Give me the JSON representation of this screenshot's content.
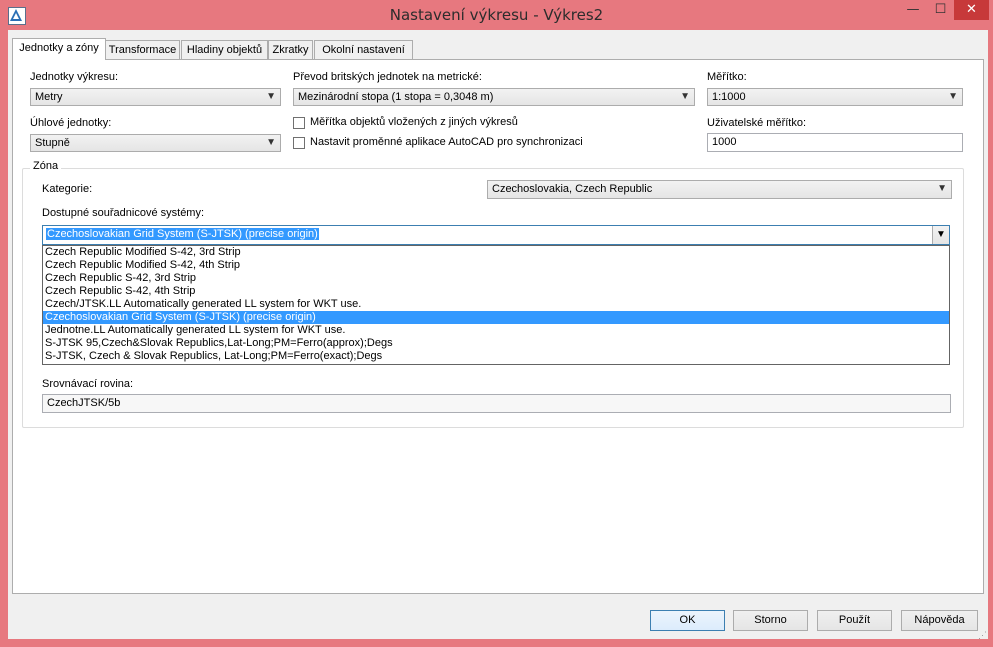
{
  "window": {
    "title": "Nastavení výkresu - Výkres2",
    "min_label": "—",
    "max_label": "☐",
    "close_label": "✕"
  },
  "tabs": [
    {
      "label": "Jednotky a zóny",
      "active": true
    },
    {
      "label": "Transformace",
      "active": false
    },
    {
      "label": "Hladiny objektů",
      "active": false
    },
    {
      "label": "Zkratky",
      "active": false
    },
    {
      "label": "Okolní nastavení",
      "active": false
    }
  ],
  "units": {
    "drawing_units_label": "Jednotky výkresu:",
    "drawing_units_value": "Metry",
    "angular_units_label": "Úhlové jednotky:",
    "angular_units_value": "Stupně",
    "imperial_label": "Převod britských jednotek na metrické:",
    "imperial_value": "Mezinárodní stopa (1 stopa = 0,3048 m)",
    "scale_objects_label": "Měřítka objektů vložených z jiných výkresů",
    "scale_objects_checked": false,
    "sync_label": "Nastavit proměnné aplikace AutoCAD pro synchronizaci",
    "sync_checked": false,
    "scale_label": "Měřítko:",
    "scale_value": "1:1000",
    "custom_scale_label": "Uživatelské měřítko:",
    "custom_scale_value": "1000"
  },
  "zone": {
    "group_label": "Zóna",
    "category_label": "Kategorie:",
    "category_value": "Czechoslovakia, Czech Republic",
    "available_label": "Dostupné souřadnicové systémy:",
    "selected_system": "Czechoslovakian Grid System (S-JTSK) (precise origin)",
    "options": [
      {
        "label": "Czech Republic Modified S-42, 3rd Strip",
        "selected": false
      },
      {
        "label": "Czech Republic Modified S-42, 4th Strip",
        "selected": false
      },
      {
        "label": "Czech Republic S-42, 3rd Strip",
        "selected": false
      },
      {
        "label": "Czech Republic S-42, 4th Strip",
        "selected": false
      },
      {
        "label": "Czech/JTSK.LL Automatically generated LL system for WKT use.",
        "selected": false
      },
      {
        "label": "Czechoslovakian Grid System (S-JTSK) (precise origin)",
        "selected": true
      },
      {
        "label": "Jednotne.LL Automatically generated LL system for WKT use.",
        "selected": false
      },
      {
        "label": "S-JTSK 95,Czech&Slovak Republics,Lat-Long;PM=Ferro(approx);Degs",
        "selected": false
      },
      {
        "label": "S-JTSK, Czech & Slovak Republics, Lat-Long;PM=Ferro(exact);Degs",
        "selected": false
      }
    ],
    "datum_label": "Srovnávací rovina:",
    "datum_value": "CzechJTSK/5b"
  },
  "buttons": {
    "ok": "OK",
    "cancel": "Storno",
    "apply": "Použít",
    "help": "Nápověda"
  },
  "icons": {
    "dropdown": "▼",
    "app_icon": "autocad-map-icon"
  }
}
